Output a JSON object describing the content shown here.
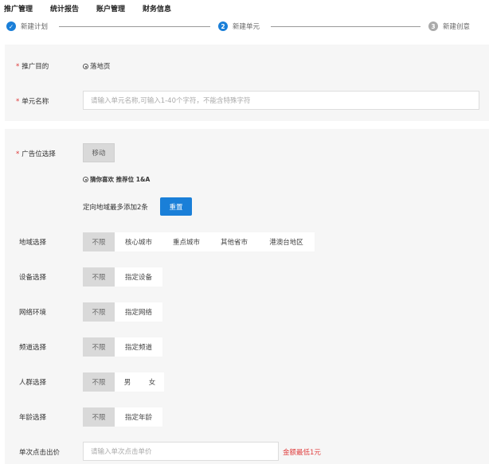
{
  "nav": [
    "推广管理",
    "统计报告",
    "账户管理",
    "财务信息"
  ],
  "steps": [
    {
      "num": "✓",
      "label": "新建计划",
      "state": "done"
    },
    {
      "num": "2",
      "label": "新建单元",
      "state": "active"
    },
    {
      "num": "3",
      "label": "新建创意",
      "state": "todo"
    }
  ],
  "basic": {
    "purpose_label": "推广目的",
    "purpose_option": "落地页",
    "name_label": "单元名称",
    "name_placeholder": "请输入单元名称,可输入1-40个字符，不能含特殊字符"
  },
  "targeting": {
    "adpos_label": "广告位选择",
    "adpos_button": "移动",
    "adpos_option": "猜你喜欢 推荐位 1&A",
    "limit_text": "定向地域最多添加2条",
    "reset_button": "重置",
    "rows": [
      {
        "label": "地域选择",
        "options": [
          "不限",
          "核心城市",
          "重点城市",
          "其他省市",
          "港澳台地区"
        ],
        "selected": 0
      },
      {
        "label": "设备选择",
        "options": [
          "不限",
          "指定设备"
        ],
        "selected": 0
      },
      {
        "label": "网络环境",
        "options": [
          "不限",
          "指定网络"
        ],
        "selected": 0
      },
      {
        "label": "频道选择",
        "options": [
          "不限",
          "指定频道"
        ],
        "selected": 0
      },
      {
        "label": "人群选择",
        "options": [
          "不限",
          "男",
          "女"
        ],
        "selected": 0
      },
      {
        "label": "年龄选择",
        "options": [
          "不限",
          "指定年龄"
        ],
        "selected": 0
      }
    ],
    "bid_label": "单次点击出价",
    "bid_placeholder": "请输入单次点击单价",
    "bid_hint": "金额最低1元"
  }
}
